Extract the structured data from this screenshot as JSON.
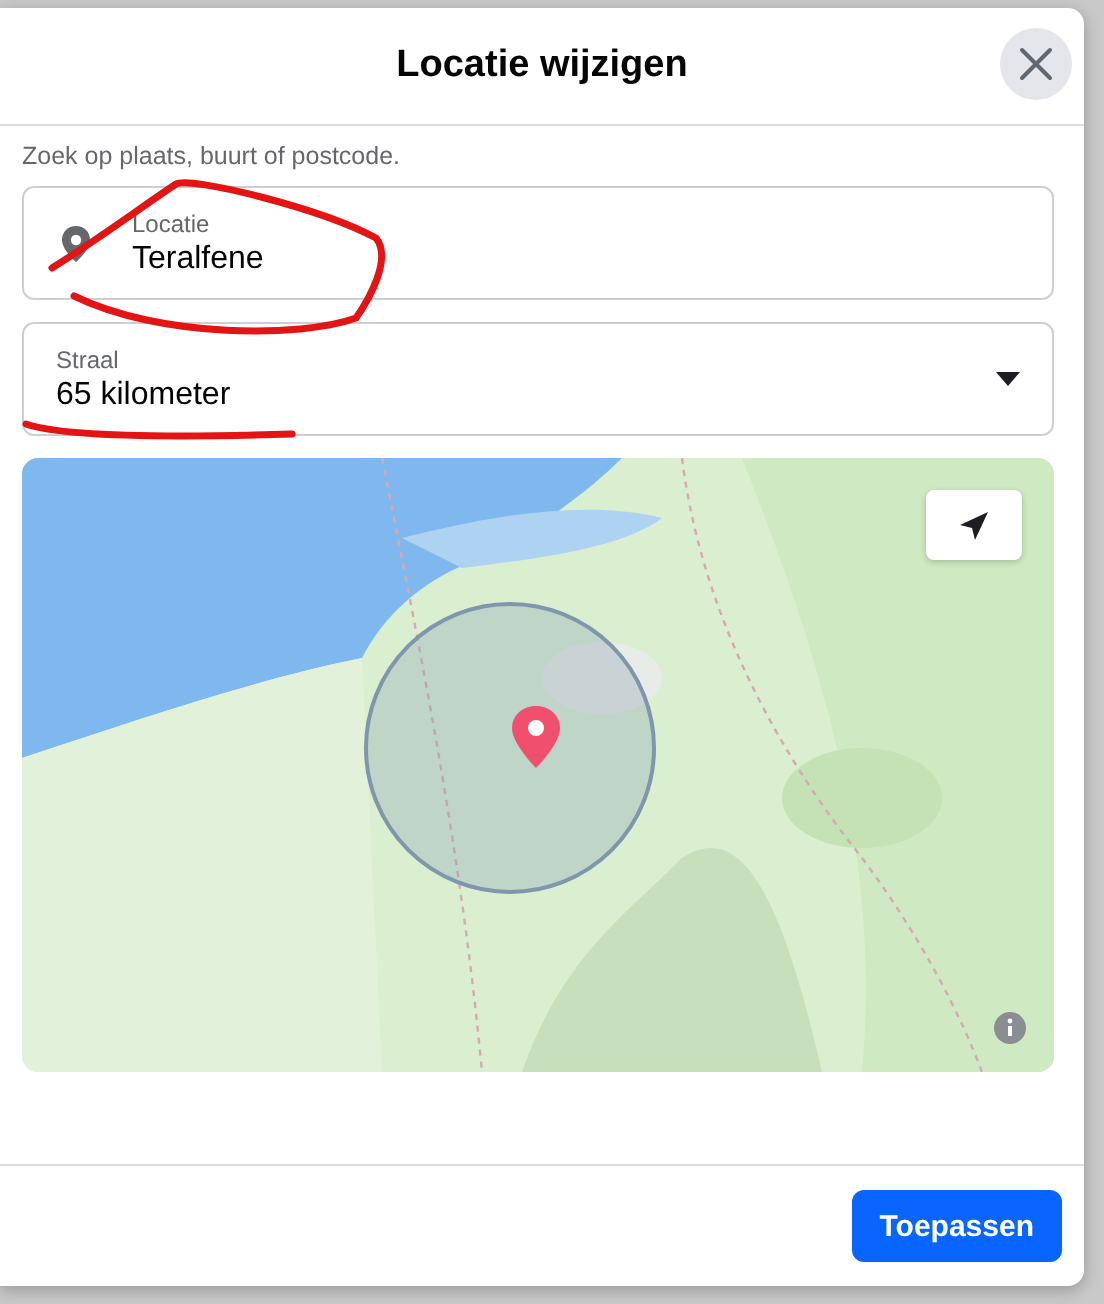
{
  "dialog": {
    "title": "Locatie wijzigen"
  },
  "hint": "Zoek op plaats, buurt of postcode.",
  "fields": [
    {
      "kind": "location",
      "label": "Locatie",
      "value": "Teralfene"
    },
    {
      "kind": "select",
      "label": "Straal",
      "value": "65 kilometer"
    }
  ],
  "buttons": [
    {
      "label": "Toepassen"
    }
  ]
}
